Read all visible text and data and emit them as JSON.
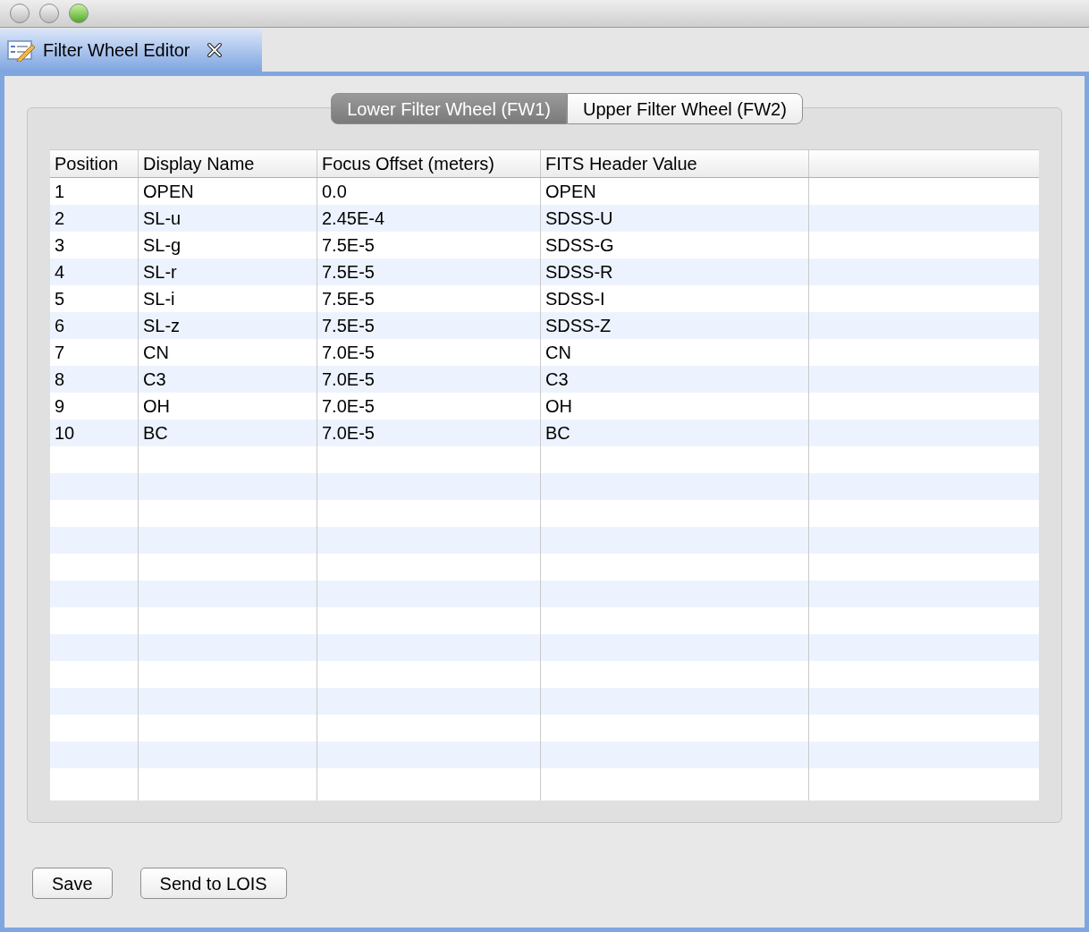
{
  "editor_tab": {
    "title": "Filter Wheel Editor",
    "selected": true
  },
  "wheel_tabs": [
    {
      "label": "Lower Filter Wheel (FW1)",
      "selected": true
    },
    {
      "label": "Upper Filter Wheel (FW2)",
      "selected": false
    }
  ],
  "table": {
    "columns": [
      "Position",
      "Display Name",
      "Focus Offset (meters)",
      "FITS Header Value"
    ],
    "rows": [
      [
        "1",
        "OPEN",
        "0.0",
        "OPEN"
      ],
      [
        "2",
        "SL-u",
        "2.45E-4",
        "SDSS-U"
      ],
      [
        "3",
        "SL-g",
        "7.5E-5",
        "SDSS-G"
      ],
      [
        "4",
        "SL-r",
        "7.5E-5",
        "SDSS-R"
      ],
      [
        "5",
        "SL-i",
        "7.5E-5",
        "SDSS-I"
      ],
      [
        "6",
        "SL-z",
        "7.5E-5",
        "SDSS-Z"
      ],
      [
        "7",
        "CN",
        "7.0E-5",
        "CN"
      ],
      [
        "8",
        "C3",
        "7.0E-5",
        "C3"
      ],
      [
        "9",
        "OH",
        "7.0E-5",
        "OH"
      ],
      [
        "10",
        "BC",
        "7.0E-5",
        "BC"
      ]
    ]
  },
  "buttons": [
    "Save",
    "Send to LOIS"
  ]
}
